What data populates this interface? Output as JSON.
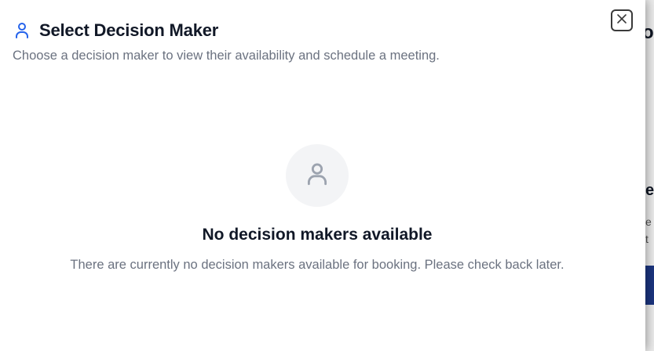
{
  "modal": {
    "title": "Select Decision Maker",
    "title_icon": "user-icon",
    "subtitle": "Choose a decision maker to view their availability and schedule a meeting.",
    "close_icon": "close-icon"
  },
  "empty_state": {
    "icon": "user-icon",
    "title": "No decision makers available",
    "description": "There are currently no decision makers available for booking. Please check back later."
  },
  "background": {
    "fragment_1": "on",
    "fragment_2": "e",
    "fragment_3": "e\nt"
  },
  "colors": {
    "accent": "#2563eb",
    "text_primary": "#111827",
    "text_muted": "#6b7280",
    "icon_muted": "#9ca3af",
    "empty_circle": "#f3f4f6",
    "background_button": "#1e3a8a"
  }
}
